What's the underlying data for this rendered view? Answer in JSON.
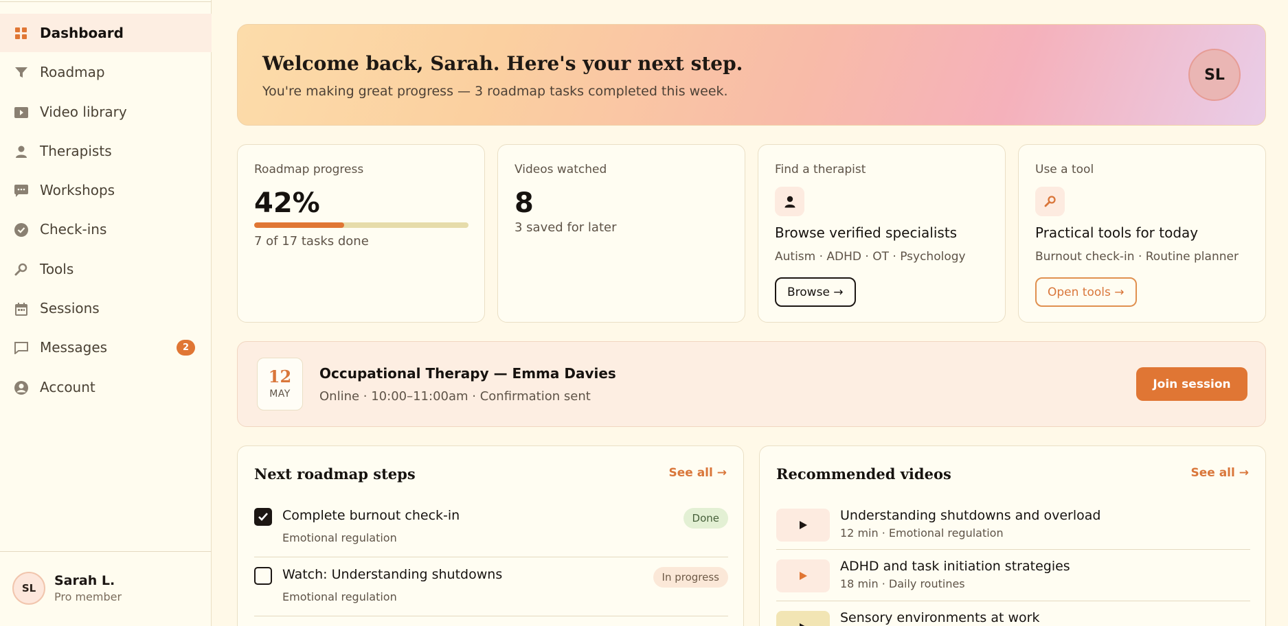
{
  "sidebar": {
    "items": [
      {
        "label": "Dashboard",
        "icon": "grid-icon",
        "active": true
      },
      {
        "label": "Roadmap",
        "icon": "funnel-icon"
      },
      {
        "label": "Video library",
        "icon": "video-icon"
      },
      {
        "label": "Therapists",
        "icon": "person-icon"
      },
      {
        "label": "Workshops",
        "icon": "chat-icon"
      },
      {
        "label": "Check-ins",
        "icon": "check-circle-icon"
      },
      {
        "label": "Tools",
        "icon": "wrench-icon"
      },
      {
        "label": "Sessions",
        "icon": "calendar-icon"
      },
      {
        "label": "Messages",
        "icon": "message-icon",
        "badge": "2"
      },
      {
        "label": "Account",
        "icon": "account-icon"
      }
    ],
    "user": {
      "initials": "SL",
      "name": "Sarah L.",
      "role": "Pro member"
    }
  },
  "hero": {
    "title": "Welcome back, Sarah. Here's your next step.",
    "subtitle": "You're making great progress — 3 roadmap tasks completed this week.",
    "avatar_initials": "SL"
  },
  "cards": {
    "roadmap": {
      "label": "Roadmap progress",
      "value": "42%",
      "progress": 0.42,
      "note": "7 of 17 tasks done"
    },
    "videos": {
      "label": "Videos watched",
      "value": "8",
      "note": "3 saved for later"
    },
    "therapist": {
      "label": "Find a therapist",
      "heading": "Browse verified specialists",
      "sub": "Autism · ADHD · OT · Psychology",
      "button": "Browse →"
    },
    "tool": {
      "label": "Use a tool",
      "heading": "Practical tools for today",
      "sub": "Burnout check-in · Routine planner",
      "button": "Open tools →"
    }
  },
  "session": {
    "day": "12",
    "month": "MAY",
    "title": "Occupational Therapy — Emma Davies",
    "details": "Online · 10:00–11:00am · Confirmation sent",
    "button": "Join session"
  },
  "roadmap_panel": {
    "title": "Next roadmap steps",
    "see_all": "See all →",
    "steps": [
      {
        "title": "Complete burnout check-in",
        "category": "Emotional regulation",
        "status": "Done",
        "checked": true
      },
      {
        "title": "Watch: Understanding shutdowns",
        "category": "Emotional regulation",
        "status": "In progress",
        "checked": false
      }
    ]
  },
  "videos_panel": {
    "title": "Recommended videos",
    "see_all": "See all →",
    "videos": [
      {
        "title": "Understanding shutdowns and overload",
        "meta": "12 min · Emotional regulation"
      },
      {
        "title": "ADHD and task initiation strategies",
        "meta": "18 min · Daily routines"
      },
      {
        "title": "Sensory environments at work",
        "meta": ""
      }
    ]
  },
  "colors": {
    "accent": "#e07634",
    "background": "#fff9e8",
    "active_nav": "#fdeee2"
  }
}
